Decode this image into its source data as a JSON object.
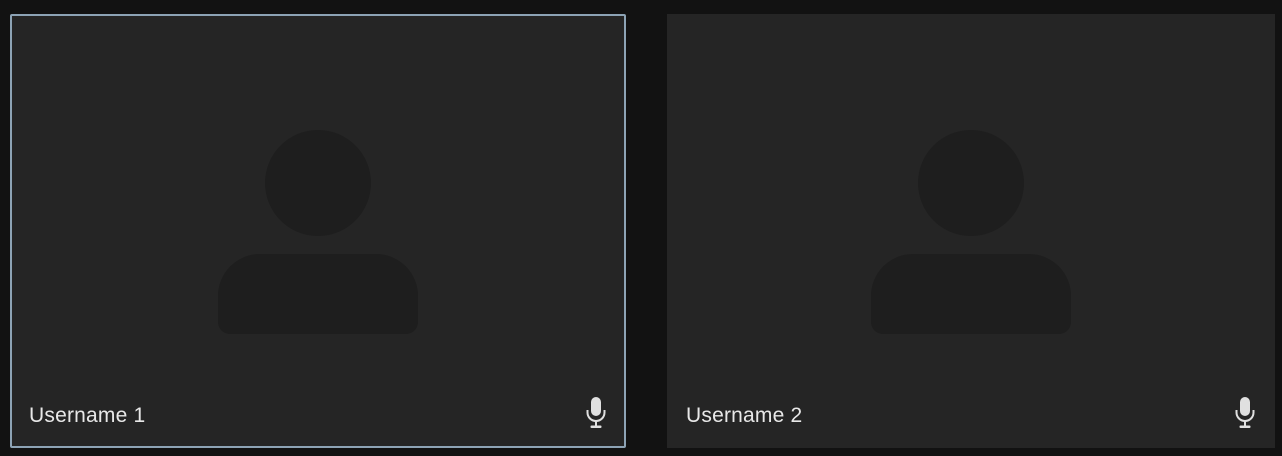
{
  "participants": [
    {
      "username": "Username 1",
      "active_speaker": true,
      "avatar_icon": "person-placeholder-icon",
      "mic_icon": "microphone-icon"
    },
    {
      "username": "Username 2",
      "active_speaker": false,
      "avatar_icon": "person-placeholder-icon",
      "mic_icon": "microphone-icon"
    }
  ],
  "colors": {
    "background": "#121212",
    "tile": "#252525",
    "avatar": "#1e1e1e",
    "active_border": "#8da3b5",
    "text": "#e8e8e8"
  }
}
